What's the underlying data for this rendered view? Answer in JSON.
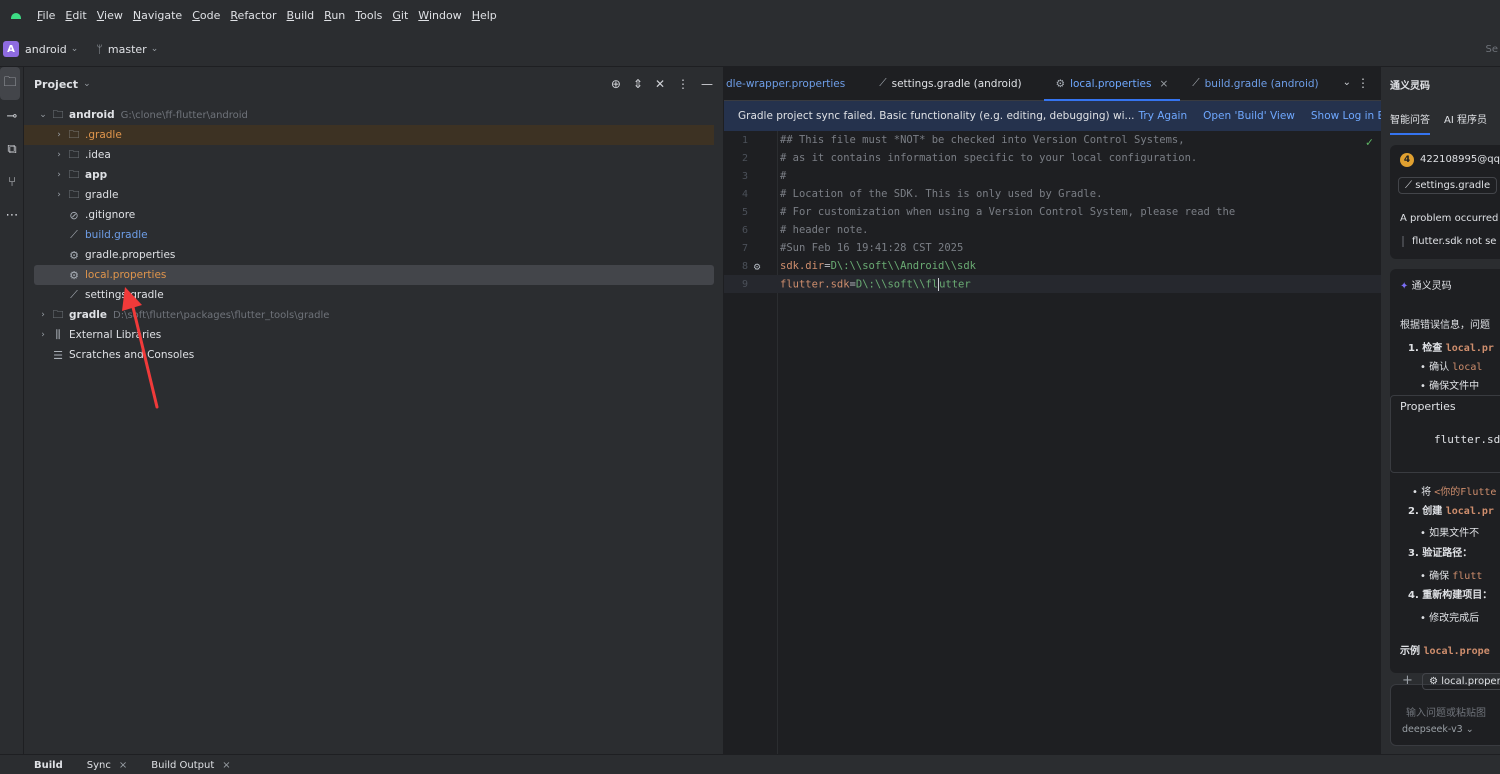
{
  "menu": [
    "File",
    "Edit",
    "View",
    "Navigate",
    "Code",
    "Refactor",
    "Build",
    "Run",
    "Tools",
    "Git",
    "Window",
    "Help"
  ],
  "toolbar": {
    "project_badge": "A",
    "project_name": "android",
    "branch": "master",
    "right_text": "Se"
  },
  "project_panel": {
    "title": "Project",
    "root": {
      "name": "android",
      "path": "G:\\clone\\ff-flutter\\android"
    },
    "items": [
      {
        "name": ".gradle"
      },
      {
        "name": ".idea"
      },
      {
        "name": "app"
      },
      {
        "name": "gradle"
      },
      {
        "name": ".gitignore"
      },
      {
        "name": "build.gradle"
      },
      {
        "name": "gradle.properties"
      },
      {
        "name": "local.properties"
      },
      {
        "name": "settings.gradle"
      }
    ],
    "gradle_root": {
      "name": "gradle",
      "path": "D:\\soft\\flutter\\packages\\flutter_tools\\gradle"
    },
    "external": "External Libraries",
    "scratches": "Scratches and Consoles"
  },
  "editor": {
    "tabs": [
      {
        "label": "dle-wrapper.properties"
      },
      {
        "label": "settings.gradle (android)"
      },
      {
        "label": "local.properties"
      },
      {
        "label": "build.gradle (android)"
      }
    ],
    "banner": {
      "message": "Gradle project sync failed. Basic functionality (e.g. editing, debugging) wi...",
      "try_again": "Try Again",
      "open_build": "Open 'Build' View",
      "show_log": "Show Log in Explorer"
    },
    "lines": [
      {
        "num": "1",
        "text": "## This file must *NOT* be checked into Version Control Systems,"
      },
      {
        "num": "2",
        "text": "# as it contains information specific to your local configuration."
      },
      {
        "num": "3",
        "text": "#"
      },
      {
        "num": "4",
        "text": "# Location of the SDK. This is only used by Gradle."
      },
      {
        "num": "5",
        "text": "# For customization when using a Version Control System, please read the"
      },
      {
        "num": "6",
        "text": "# header note."
      },
      {
        "num": "7",
        "text": "#Sun Feb 16 19:41:28 CST 2025"
      },
      {
        "num": "8",
        "key": "sdk.dir",
        "eq": "=",
        "value": "D\\:\\\\soft\\\\Android\\\\sdk"
      },
      {
        "num": "9",
        "key": "flutter.sdk",
        "eq": "=",
        "value_a": "D\\:\\\\soft\\\\fl",
        "value_b": "utter"
      }
    ]
  },
  "ai_panel": {
    "title": "通义灵码",
    "tabs": [
      "智能问答",
      "AI 程序员"
    ],
    "user_avatar": "4",
    "user": "422108995@qq",
    "context_chip": "settings.gradle",
    "problem": "A problem occurred",
    "quote": "flutter.sdk not se",
    "bot_name": "通义灵码",
    "intro": "根据错误信息，问题",
    "step1_prefix": "1. 检查 ",
    "step1_code": "local.pr",
    "step1_b1_prefix": "• 确认 ",
    "step1_b1_code": "local",
    "step1_b2": "• 确保文件中",
    "code_lang": "Properties",
    "code_text": "flutter.sd",
    "note_prefix": "• 将 ",
    "note_code": "<你的Flutte",
    "step2_prefix": "2. 创建 ",
    "step2_code": "local.pr",
    "step2_b1": "• 如果文件不",
    "step3": "3. 验证路径：",
    "step3_b1_prefix": "• 确保 ",
    "step3_b1_code": "flutt",
    "step4": "4. 重新构建项目：",
    "step4_b1": "• 修改完成后",
    "example_prefix": "示例 ",
    "example_code": "local.prope",
    "input_chip": "local.proper",
    "input_placeholder": "输入问题或粘贴图",
    "model": "deepseek-v3"
  },
  "bottom": {
    "tabs": [
      "Build",
      "Sync",
      "Build Output"
    ]
  }
}
